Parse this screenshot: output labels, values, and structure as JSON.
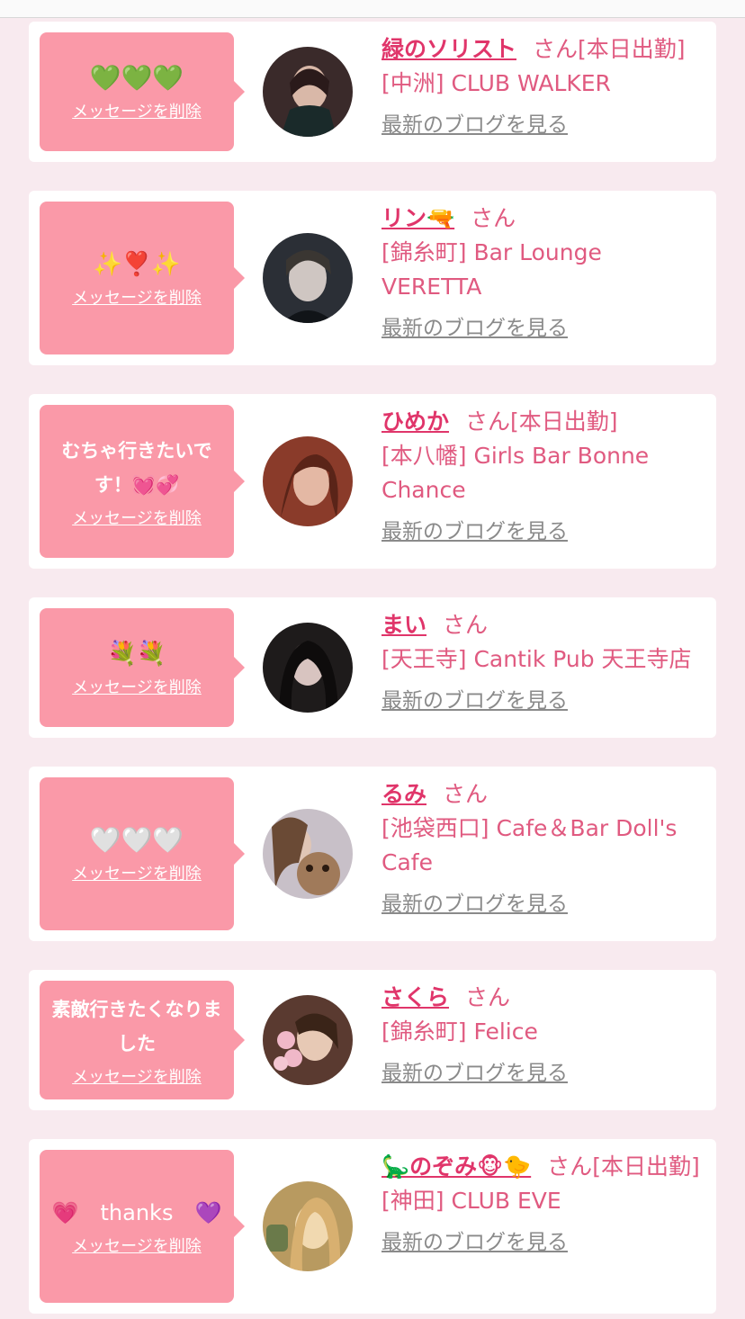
{
  "ui": {
    "delete_label": "メッセージを削除",
    "blog_label": "最新のブログを見る",
    "san": "さん"
  },
  "colors": {
    "background": "#f8eaef",
    "bubble": "#fa99a8",
    "name": "#e0356a",
    "shop_text": "#e05a80",
    "blog_link": "#8a8a8a"
  },
  "cards": [
    {
      "message": "💚💚💚",
      "name": "緑のソリスト",
      "status": "[本日出勤]",
      "shop": "[中洲] CLUB WALKER"
    },
    {
      "message": "✨❣️✨",
      "name": "リン🔫",
      "status": "",
      "shop": "[錦糸町] Bar Lounge VERETTA"
    },
    {
      "message": "むちゃ行きたいです！💓💞",
      "name": "ひめか",
      "status": "[本日出勤]",
      "shop": "[本八幡] Girls Bar Bonne Chance"
    },
    {
      "message": "💐💐",
      "name": "まい",
      "status": "",
      "shop": "[天王寺] Cantik Pub 天王寺店"
    },
    {
      "message": "🤍🤍🤍",
      "name": "るみ",
      "status": "",
      "shop": "[池袋西口] Cafe＆Bar Doll's Cafe"
    },
    {
      "message": "素敵行きたくなりました",
      "name": "さくら",
      "status": "",
      "shop": "[錦糸町] Felice"
    },
    {
      "message": "💗　thanks　💜",
      "name": "🦕のぞみ🐵🐤",
      "status": "[本日出勤]",
      "shop": "[神田] CLUB EVE"
    }
  ],
  "avatars": [
    {
      "icon": "avatar-photo",
      "palette": [
        "#3a2a2a",
        "#d9b8a8",
        "#1a2a2a"
      ]
    },
    {
      "icon": "avatar-photo",
      "palette": [
        "#2b2f36",
        "#cfc6c2",
        "#111418"
      ]
    },
    {
      "icon": "avatar-photo",
      "palette": [
        "#8a3b2a",
        "#e4b8a4",
        "#5a2418"
      ]
    },
    {
      "icon": "avatar-photo",
      "palette": [
        "#1e1b1b",
        "#d8c4c0",
        "#0e0c0c"
      ]
    },
    {
      "icon": "avatar-photo",
      "palette": [
        "#c8c0c8",
        "#a07a5a",
        "#6a4a35"
      ]
    },
    {
      "icon": "avatar-photo",
      "palette": [
        "#5a3a30",
        "#f0b8c8",
        "#e7c9b5"
      ]
    },
    {
      "icon": "avatar-photo",
      "palette": [
        "#b89a60",
        "#f1d9b0",
        "#6a7a4a"
      ]
    }
  ]
}
